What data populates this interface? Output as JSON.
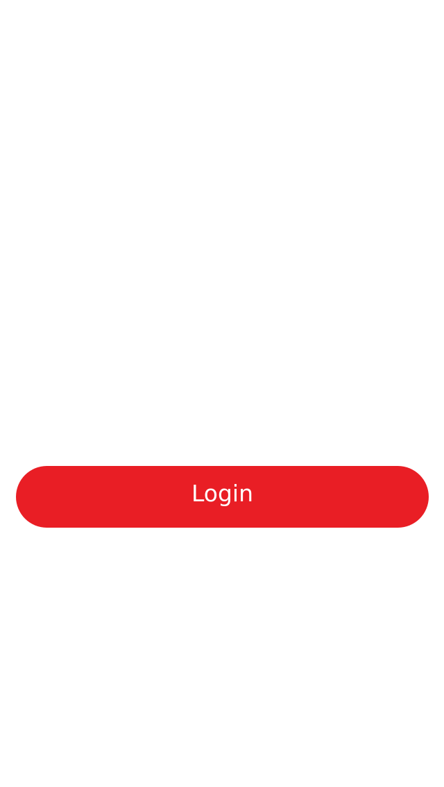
{
  "login": {
    "label": "Login",
    "color": "#E91E25"
  }
}
